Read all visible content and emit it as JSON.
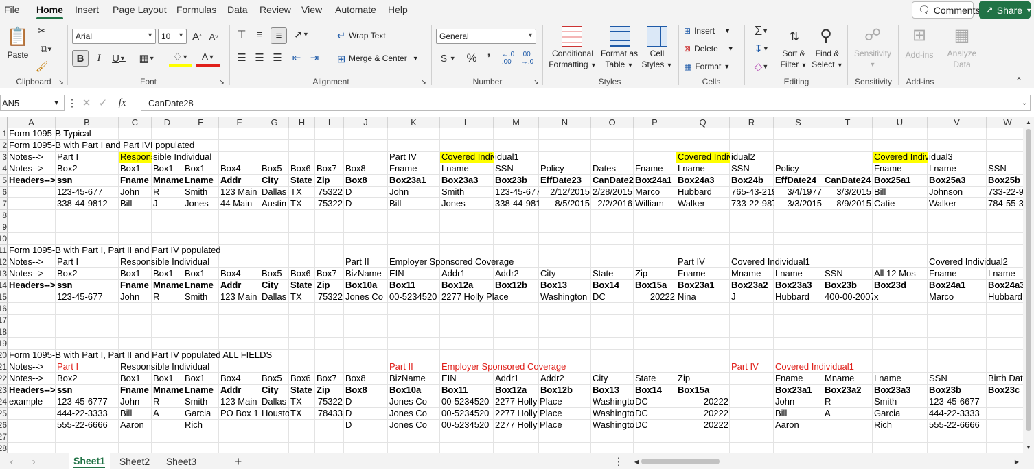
{
  "menu": [
    "File",
    "Home",
    "Insert",
    "Page Layout",
    "Formulas",
    "Data",
    "Review",
    "View",
    "Automate",
    "Help"
  ],
  "menu_active": "Home",
  "top_buttons": {
    "comments": "Comments",
    "share": "Share"
  },
  "ribbon": {
    "clipboard": {
      "paste": "Paste",
      "label": "Clipboard"
    },
    "font": {
      "name": "Arial",
      "size": "10",
      "label": "Font"
    },
    "alignment": {
      "wrap": "Wrap Text",
      "merge": "Merge & Center",
      "label": "Alignment"
    },
    "number": {
      "format": "General",
      "label": "Number"
    },
    "styles": {
      "conditional": [
        "Conditional",
        "Formatting"
      ],
      "format_table": [
        "Format as",
        "Table"
      ],
      "cell_styles": [
        "Cell",
        "Styles"
      ],
      "label": "Styles"
    },
    "cells": {
      "insert": "Insert",
      "delete": "Delete",
      "format": "Format",
      "label": "Cells"
    },
    "editing": {
      "sort": [
        "Sort &",
        "Filter"
      ],
      "find": [
        "Find &",
        "Select"
      ],
      "label": "Editing"
    },
    "sensitivity": {
      "btn": "Sensitivity",
      "label": "Sensitivity"
    },
    "addins": {
      "btn": "Add-ins",
      "label": "Add-ins"
    },
    "analyze": {
      "btn": [
        "Analyze",
        "Data"
      ]
    }
  },
  "formula_bar": {
    "namebox": "AN5",
    "fx": "fx",
    "formula": "CanDate28"
  },
  "columns": [
    "A",
    "B",
    "C",
    "D",
    "E",
    "F",
    "G",
    "H",
    "I",
    "J",
    "K",
    "L",
    "M",
    "N",
    "O",
    "P",
    "Q",
    "R",
    "S",
    "T",
    "U",
    "V",
    "W"
  ],
  "rows": [
    "1",
    "2",
    "3",
    "4",
    "5",
    "6",
    "7",
    "8",
    "9",
    "10",
    "11",
    "12",
    "13",
    "14",
    "15",
    "16",
    "17",
    "18",
    "19",
    "20",
    "21",
    "22",
    "23",
    "24",
    "25",
    "26",
    "27",
    "28"
  ],
  "cells": [
    [
      0,
      "A",
      "Form 1095-B Typical",
      ""
    ],
    [
      1,
      "A",
      "Form 1095-B with Part I and Part IVI populated",
      ""
    ],
    [
      2,
      "A",
      "Notes-->",
      ""
    ],
    [
      2,
      "B",
      "Part I",
      ""
    ],
    [
      2,
      "C",
      "Respons",
      "yl"
    ],
    [
      2,
      "D",
      "sible Individual",
      ""
    ],
    [
      2,
      "K",
      "Part IV",
      ""
    ],
    [
      2,
      "L",
      "Covered Indiv",
      "yl"
    ],
    [
      2,
      "M",
      "idual1",
      ""
    ],
    [
      2,
      "Q",
      "Covered Indiv",
      "yl"
    ],
    [
      2,
      "R",
      "idual2",
      ""
    ],
    [
      2,
      "U",
      "Covered Indiv",
      "yl"
    ],
    [
      2,
      "V",
      "idual3",
      ""
    ],
    [
      3,
      "A",
      "Notes-->",
      ""
    ],
    [
      3,
      "B",
      "Box2",
      ""
    ],
    [
      3,
      "C",
      "Box1",
      ""
    ],
    [
      3,
      "D",
      "Box1",
      ""
    ],
    [
      3,
      "E",
      "Box1",
      ""
    ],
    [
      3,
      "F",
      "Box4",
      ""
    ],
    [
      3,
      "G",
      "Box5",
      ""
    ],
    [
      3,
      "H",
      "Box6",
      ""
    ],
    [
      3,
      "I",
      "Box7",
      ""
    ],
    [
      3,
      "J",
      "Box8",
      ""
    ],
    [
      3,
      "K",
      "Fname",
      ""
    ],
    [
      3,
      "L",
      "Lname",
      ""
    ],
    [
      3,
      "M",
      "SSN",
      ""
    ],
    [
      3,
      "N",
      "Policy",
      ""
    ],
    [
      3,
      "O",
      "Dates",
      ""
    ],
    [
      3,
      "P",
      "Fname",
      ""
    ],
    [
      3,
      "Q",
      "Lname",
      ""
    ],
    [
      3,
      "R",
      "SSN",
      ""
    ],
    [
      3,
      "S",
      "Policy",
      ""
    ],
    [
      3,
      "U",
      "Fname",
      ""
    ],
    [
      3,
      "V",
      "Lname",
      ""
    ],
    [
      3,
      "W",
      "SSN",
      ""
    ],
    [
      4,
      "A",
      "Headers-->",
      "b"
    ],
    [
      4,
      "B",
      "ssn",
      "b"
    ],
    [
      4,
      "C",
      "Fname",
      "b"
    ],
    [
      4,
      "D",
      "Mname",
      "b"
    ],
    [
      4,
      "E",
      "Lname",
      "b"
    ],
    [
      4,
      "F",
      "Addr",
      "b"
    ],
    [
      4,
      "G",
      "City",
      "b"
    ],
    [
      4,
      "H",
      "State",
      "b"
    ],
    [
      4,
      "I",
      "Zip",
      "b"
    ],
    [
      4,
      "J",
      "Box8",
      "b"
    ],
    [
      4,
      "K",
      "Box23a1",
      "b"
    ],
    [
      4,
      "L",
      "Box23a3",
      "b"
    ],
    [
      4,
      "M",
      "Box23b",
      "b"
    ],
    [
      4,
      "N",
      "EffDate23",
      "b"
    ],
    [
      4,
      "O",
      "CanDate23",
      "b"
    ],
    [
      4,
      "P",
      "Box24a1",
      "b"
    ],
    [
      4,
      "Q",
      "Box24a3",
      "b"
    ],
    [
      4,
      "R",
      "Box24b",
      "b"
    ],
    [
      4,
      "S",
      "EffDate24",
      "b"
    ],
    [
      4,
      "T",
      "CanDate24",
      "b"
    ],
    [
      4,
      "U",
      "Box25a1",
      "b"
    ],
    [
      4,
      "V",
      "Box25a3",
      "b"
    ],
    [
      4,
      "W",
      "Box25b",
      "b"
    ],
    [
      5,
      "B",
      "123-45-677",
      ""
    ],
    [
      5,
      "C",
      "John",
      ""
    ],
    [
      5,
      "D",
      "R",
      ""
    ],
    [
      5,
      "E",
      "Smith",
      ""
    ],
    [
      5,
      "F",
      "123 Main",
      ""
    ],
    [
      5,
      "G",
      "Dallas",
      ""
    ],
    [
      5,
      "H",
      "TX",
      ""
    ],
    [
      5,
      "I",
      "75322",
      "r"
    ],
    [
      5,
      "J",
      "D",
      ""
    ],
    [
      5,
      "K",
      "John",
      ""
    ],
    [
      5,
      "L",
      "Smith",
      ""
    ],
    [
      5,
      "M",
      "123-45-677",
      ""
    ],
    [
      5,
      "N",
      "2/12/2015",
      "r"
    ],
    [
      5,
      "O",
      "2/28/2015",
      "r"
    ],
    [
      5,
      "P",
      "Marco",
      ""
    ],
    [
      5,
      "Q",
      "Hubbard",
      ""
    ],
    [
      5,
      "R",
      "765-43-219",
      ""
    ],
    [
      5,
      "S",
      "3/4/1977",
      "r"
    ],
    [
      5,
      "T",
      "3/3/2015",
      "r"
    ],
    [
      5,
      "U",
      "Bill",
      ""
    ],
    [
      5,
      "V",
      "Johnson",
      ""
    ],
    [
      5,
      "W",
      "733-22-98",
      ""
    ],
    [
      6,
      "B",
      "338-44-9812",
      ""
    ],
    [
      6,
      "C",
      "Bill",
      ""
    ],
    [
      6,
      "D",
      "J",
      ""
    ],
    [
      6,
      "E",
      "Jones",
      ""
    ],
    [
      6,
      "F",
      "44 Main",
      ""
    ],
    [
      6,
      "G",
      "Austin",
      ""
    ],
    [
      6,
      "H",
      "TX",
      ""
    ],
    [
      6,
      "I",
      "75322",
      "r"
    ],
    [
      6,
      "J",
      "D",
      ""
    ],
    [
      6,
      "K",
      "Bill",
      ""
    ],
    [
      6,
      "L",
      "Jones",
      ""
    ],
    [
      6,
      "M",
      "338-44-981",
      ""
    ],
    [
      6,
      "N",
      "8/5/2015",
      "r"
    ],
    [
      6,
      "O",
      "2/2/2016",
      "r"
    ],
    [
      6,
      "P",
      "William",
      ""
    ],
    [
      6,
      "Q",
      "Walker",
      ""
    ],
    [
      6,
      "R",
      "733-22-987",
      ""
    ],
    [
      6,
      "S",
      "3/3/2015",
      "r"
    ],
    [
      6,
      "T",
      "8/9/2015",
      "r"
    ],
    [
      6,
      "U",
      "Catie",
      ""
    ],
    [
      6,
      "V",
      "Walker",
      ""
    ],
    [
      6,
      "W",
      "784-55-3",
      ""
    ],
    [
      10,
      "A",
      "Form 1095-B with Part I,  Part II  and Part IV populated",
      ""
    ],
    [
      11,
      "A",
      "Notes-->",
      ""
    ],
    [
      11,
      "B",
      "Part I",
      ""
    ],
    [
      11,
      "C",
      "Responsible Individual",
      ""
    ],
    [
      11,
      "J",
      "Part II",
      ""
    ],
    [
      11,
      "K",
      "Employer Sponsored Coverage",
      ""
    ],
    [
      11,
      "Q",
      "Part IV",
      ""
    ],
    [
      11,
      "R",
      "Covered Individual1",
      ""
    ],
    [
      11,
      "V",
      "Covered Individual2",
      ""
    ],
    [
      12,
      "A",
      "Notes-->",
      ""
    ],
    [
      12,
      "B",
      "Box2",
      ""
    ],
    [
      12,
      "C",
      "Box1",
      ""
    ],
    [
      12,
      "D",
      "Box1",
      ""
    ],
    [
      12,
      "E",
      "Box1",
      ""
    ],
    [
      12,
      "F",
      "Box4",
      ""
    ],
    [
      12,
      "G",
      "Box5",
      ""
    ],
    [
      12,
      "H",
      "Box6",
      ""
    ],
    [
      12,
      "I",
      "Box7",
      ""
    ],
    [
      12,
      "J",
      "BizName",
      ""
    ],
    [
      12,
      "K",
      "EIN",
      ""
    ],
    [
      12,
      "L",
      "Addr1",
      ""
    ],
    [
      12,
      "M",
      "Addr2",
      ""
    ],
    [
      12,
      "N",
      "City",
      ""
    ],
    [
      12,
      "O",
      "State",
      ""
    ],
    [
      12,
      "P",
      "Zip",
      ""
    ],
    [
      12,
      "Q",
      "Fname",
      ""
    ],
    [
      12,
      "R",
      "Mname",
      ""
    ],
    [
      12,
      "S",
      "Lname",
      ""
    ],
    [
      12,
      "T",
      "SSN",
      ""
    ],
    [
      12,
      "U",
      "All 12 Mos",
      ""
    ],
    [
      12,
      "V",
      "Fname",
      ""
    ],
    [
      12,
      "W",
      "Lname",
      ""
    ],
    [
      13,
      "A",
      "Headers-->",
      "b"
    ],
    [
      13,
      "B",
      "ssn",
      "b"
    ],
    [
      13,
      "C",
      "Fname",
      "b"
    ],
    [
      13,
      "D",
      "Mname",
      "b"
    ],
    [
      13,
      "E",
      "Lname",
      "b"
    ],
    [
      13,
      "F",
      "Addr",
      "b"
    ],
    [
      13,
      "G",
      "City",
      "b"
    ],
    [
      13,
      "H",
      "State",
      "b"
    ],
    [
      13,
      "I",
      "Zip",
      "b"
    ],
    [
      13,
      "J",
      "Box10a",
      "b"
    ],
    [
      13,
      "K",
      "Box11",
      "b"
    ],
    [
      13,
      "L",
      "Box12a",
      "b"
    ],
    [
      13,
      "M",
      "Box12b",
      "b"
    ],
    [
      13,
      "N",
      "Box13",
      "b"
    ],
    [
      13,
      "O",
      "Box14",
      "b"
    ],
    [
      13,
      "P",
      "Box15a",
      "b"
    ],
    [
      13,
      "Q",
      "Box23a1",
      "b"
    ],
    [
      13,
      "R",
      "Box23a2",
      "b"
    ],
    [
      13,
      "S",
      "Box23a3",
      "b"
    ],
    [
      13,
      "T",
      "Box23b",
      "b"
    ],
    [
      13,
      "U",
      "Box23d",
      "b"
    ],
    [
      13,
      "V",
      "Box24a1",
      "b"
    ],
    [
      13,
      "W",
      "Box24a3",
      "b"
    ],
    [
      14,
      "B",
      "123-45-677",
      ""
    ],
    [
      14,
      "C",
      "John",
      ""
    ],
    [
      14,
      "D",
      "R",
      ""
    ],
    [
      14,
      "E",
      "Smith",
      ""
    ],
    [
      14,
      "F",
      "123 Main",
      ""
    ],
    [
      14,
      "G",
      "Dallas",
      ""
    ],
    [
      14,
      "H",
      "TX",
      ""
    ],
    [
      14,
      "I",
      "75322",
      "r"
    ],
    [
      14,
      "J",
      "Jones Co",
      ""
    ],
    [
      14,
      "K",
      "00-5234520",
      ""
    ],
    [
      14,
      "L",
      "2277 Holly Place",
      ""
    ],
    [
      14,
      "N",
      "Washington",
      ""
    ],
    [
      14,
      "O",
      "DC",
      ""
    ],
    [
      14,
      "P",
      "20222",
      "r"
    ],
    [
      14,
      "Q",
      "Nina",
      ""
    ],
    [
      14,
      "R",
      "J",
      ""
    ],
    [
      14,
      "S",
      "Hubbard",
      ""
    ],
    [
      14,
      "T",
      "400-00-2007",
      ""
    ],
    [
      14,
      "U",
      "x",
      ""
    ],
    [
      14,
      "V",
      "Marco",
      ""
    ],
    [
      14,
      "W",
      "Hubbard",
      ""
    ],
    [
      19,
      "A",
      "Form 1095-B with Part I,  Part II  and Part IV populated ALL FIELDS",
      ""
    ],
    [
      20,
      "A",
      "Notes-->",
      ""
    ],
    [
      20,
      "B",
      "Part I",
      "red"
    ],
    [
      20,
      "C",
      "Responsible Individual",
      ""
    ],
    [
      20,
      "K",
      "Part II",
      "red"
    ],
    [
      20,
      "L",
      "Employer Sponsored Coverage",
      "red"
    ],
    [
      20,
      "R",
      "Part IV",
      "red"
    ],
    [
      20,
      "S",
      "Covered Individual1",
      "red"
    ],
    [
      21,
      "A",
      "Notes-->",
      ""
    ],
    [
      21,
      "B",
      "Box2",
      ""
    ],
    [
      21,
      "C",
      "Box1",
      ""
    ],
    [
      21,
      "D",
      "Box1",
      ""
    ],
    [
      21,
      "E",
      "Box1",
      ""
    ],
    [
      21,
      "F",
      "Box4",
      ""
    ],
    [
      21,
      "G",
      "Box5",
      ""
    ],
    [
      21,
      "H",
      "Box6",
      ""
    ],
    [
      21,
      "I",
      "Box7",
      ""
    ],
    [
      21,
      "J",
      "Box8",
      ""
    ],
    [
      21,
      "K",
      "BizName",
      ""
    ],
    [
      21,
      "L",
      "EIN",
      ""
    ],
    [
      21,
      "M",
      "Addr1",
      ""
    ],
    [
      21,
      "N",
      "Addr2",
      ""
    ],
    [
      21,
      "O",
      "City",
      ""
    ],
    [
      21,
      "P",
      "State",
      ""
    ],
    [
      21,
      "Q",
      "Zip",
      ""
    ],
    [
      21,
      "S",
      "Fname",
      ""
    ],
    [
      21,
      "T",
      "Mname",
      ""
    ],
    [
      21,
      "U",
      "Lname",
      ""
    ],
    [
      21,
      "V",
      "SSN",
      ""
    ],
    [
      21,
      "W",
      "Birth Dat",
      ""
    ],
    [
      22,
      "A",
      "Headers-->",
      "b"
    ],
    [
      22,
      "B",
      "ssn",
      "b"
    ],
    [
      22,
      "C",
      "Fname",
      "b"
    ],
    [
      22,
      "D",
      "Mname",
      "b"
    ],
    [
      22,
      "E",
      "Lname",
      "b"
    ],
    [
      22,
      "F",
      "Addr",
      "b"
    ],
    [
      22,
      "G",
      "City",
      "b"
    ],
    [
      22,
      "H",
      "State",
      "b"
    ],
    [
      22,
      "I",
      "Zip",
      "b"
    ],
    [
      22,
      "J",
      "Box8",
      "b"
    ],
    [
      22,
      "K",
      "Box10a",
      "b"
    ],
    [
      22,
      "L",
      "Box11",
      "b"
    ],
    [
      22,
      "M",
      "Box12a",
      "b"
    ],
    [
      22,
      "N",
      "Box12b",
      "b"
    ],
    [
      22,
      "O",
      "Box13",
      "b"
    ],
    [
      22,
      "P",
      "Box14",
      "b"
    ],
    [
      22,
      "Q",
      "Box15a",
      "b"
    ],
    [
      22,
      "S",
      "Box23a1",
      "b"
    ],
    [
      22,
      "T",
      "Box23a2",
      "b"
    ],
    [
      22,
      "U",
      "Box23a3",
      "b"
    ],
    [
      22,
      "V",
      "Box23b",
      "b"
    ],
    [
      22,
      "W",
      "Box23c",
      "b"
    ],
    [
      23,
      "A",
      "example",
      ""
    ],
    [
      23,
      "B",
      "123-45-6777",
      ""
    ],
    [
      23,
      "C",
      "John",
      ""
    ],
    [
      23,
      "D",
      "R",
      ""
    ],
    [
      23,
      "E",
      "Smith",
      ""
    ],
    [
      23,
      "F",
      "123 Main",
      ""
    ],
    [
      23,
      "G",
      "Dallas",
      ""
    ],
    [
      23,
      "H",
      "TX",
      ""
    ],
    [
      23,
      "I",
      "75322",
      "r"
    ],
    [
      23,
      "J",
      "D",
      ""
    ],
    [
      23,
      "K",
      "Jones Co",
      ""
    ],
    [
      23,
      "L",
      "00-5234520",
      ""
    ],
    [
      23,
      "M",
      "2277 Holly Place",
      ""
    ],
    [
      23,
      "O",
      "Washington",
      ""
    ],
    [
      23,
      "P",
      "DC",
      ""
    ],
    [
      23,
      "Q",
      "20222",
      "r"
    ],
    [
      23,
      "S",
      "John",
      ""
    ],
    [
      23,
      "T",
      "R",
      ""
    ],
    [
      23,
      "U",
      "Smith",
      ""
    ],
    [
      23,
      "V",
      "123-45-6677",
      ""
    ],
    [
      24,
      "B",
      "444-22-3333",
      ""
    ],
    [
      24,
      "C",
      "Bill",
      ""
    ],
    [
      24,
      "D",
      "A",
      ""
    ],
    [
      24,
      "E",
      "Garcia",
      ""
    ],
    [
      24,
      "F",
      "PO Box 1",
      ""
    ],
    [
      24,
      "G",
      "Houston",
      ""
    ],
    [
      24,
      "H",
      "TX",
      ""
    ],
    [
      24,
      "I",
      "78433",
      "r"
    ],
    [
      24,
      "J",
      "D",
      ""
    ],
    [
      24,
      "K",
      "Jones Co",
      ""
    ],
    [
      24,
      "L",
      "00-5234520",
      ""
    ],
    [
      24,
      "M",
      "2277 Holly Place",
      ""
    ],
    [
      24,
      "O",
      "Washington",
      ""
    ],
    [
      24,
      "P",
      "DC",
      ""
    ],
    [
      24,
      "Q",
      "20222",
      "r"
    ],
    [
      24,
      "S",
      "Bill",
      ""
    ],
    [
      24,
      "T",
      "A",
      ""
    ],
    [
      24,
      "U",
      "Garcia",
      ""
    ],
    [
      24,
      "V",
      "444-22-3333",
      ""
    ],
    [
      25,
      "B",
      "555-22-6666",
      ""
    ],
    [
      25,
      "C",
      "Aaron",
      ""
    ],
    [
      25,
      "E",
      "Rich",
      ""
    ],
    [
      25,
      "J",
      "D",
      ""
    ],
    [
      25,
      "K",
      "Jones Co",
      ""
    ],
    [
      25,
      "L",
      "00-5234520",
      ""
    ],
    [
      25,
      "M",
      "2277 Holly Place",
      ""
    ],
    [
      25,
      "O",
      "Washington",
      ""
    ],
    [
      25,
      "P",
      "DC",
      ""
    ],
    [
      25,
      "Q",
      "20222",
      "r"
    ],
    [
      25,
      "S",
      "Aaron",
      ""
    ],
    [
      25,
      "U",
      "Rich",
      ""
    ],
    [
      25,
      "V",
      "555-22-6666",
      ""
    ]
  ],
  "sheets": [
    "Sheet1",
    "Sheet2",
    "Sheet3"
  ],
  "active_sheet": "Sheet1"
}
